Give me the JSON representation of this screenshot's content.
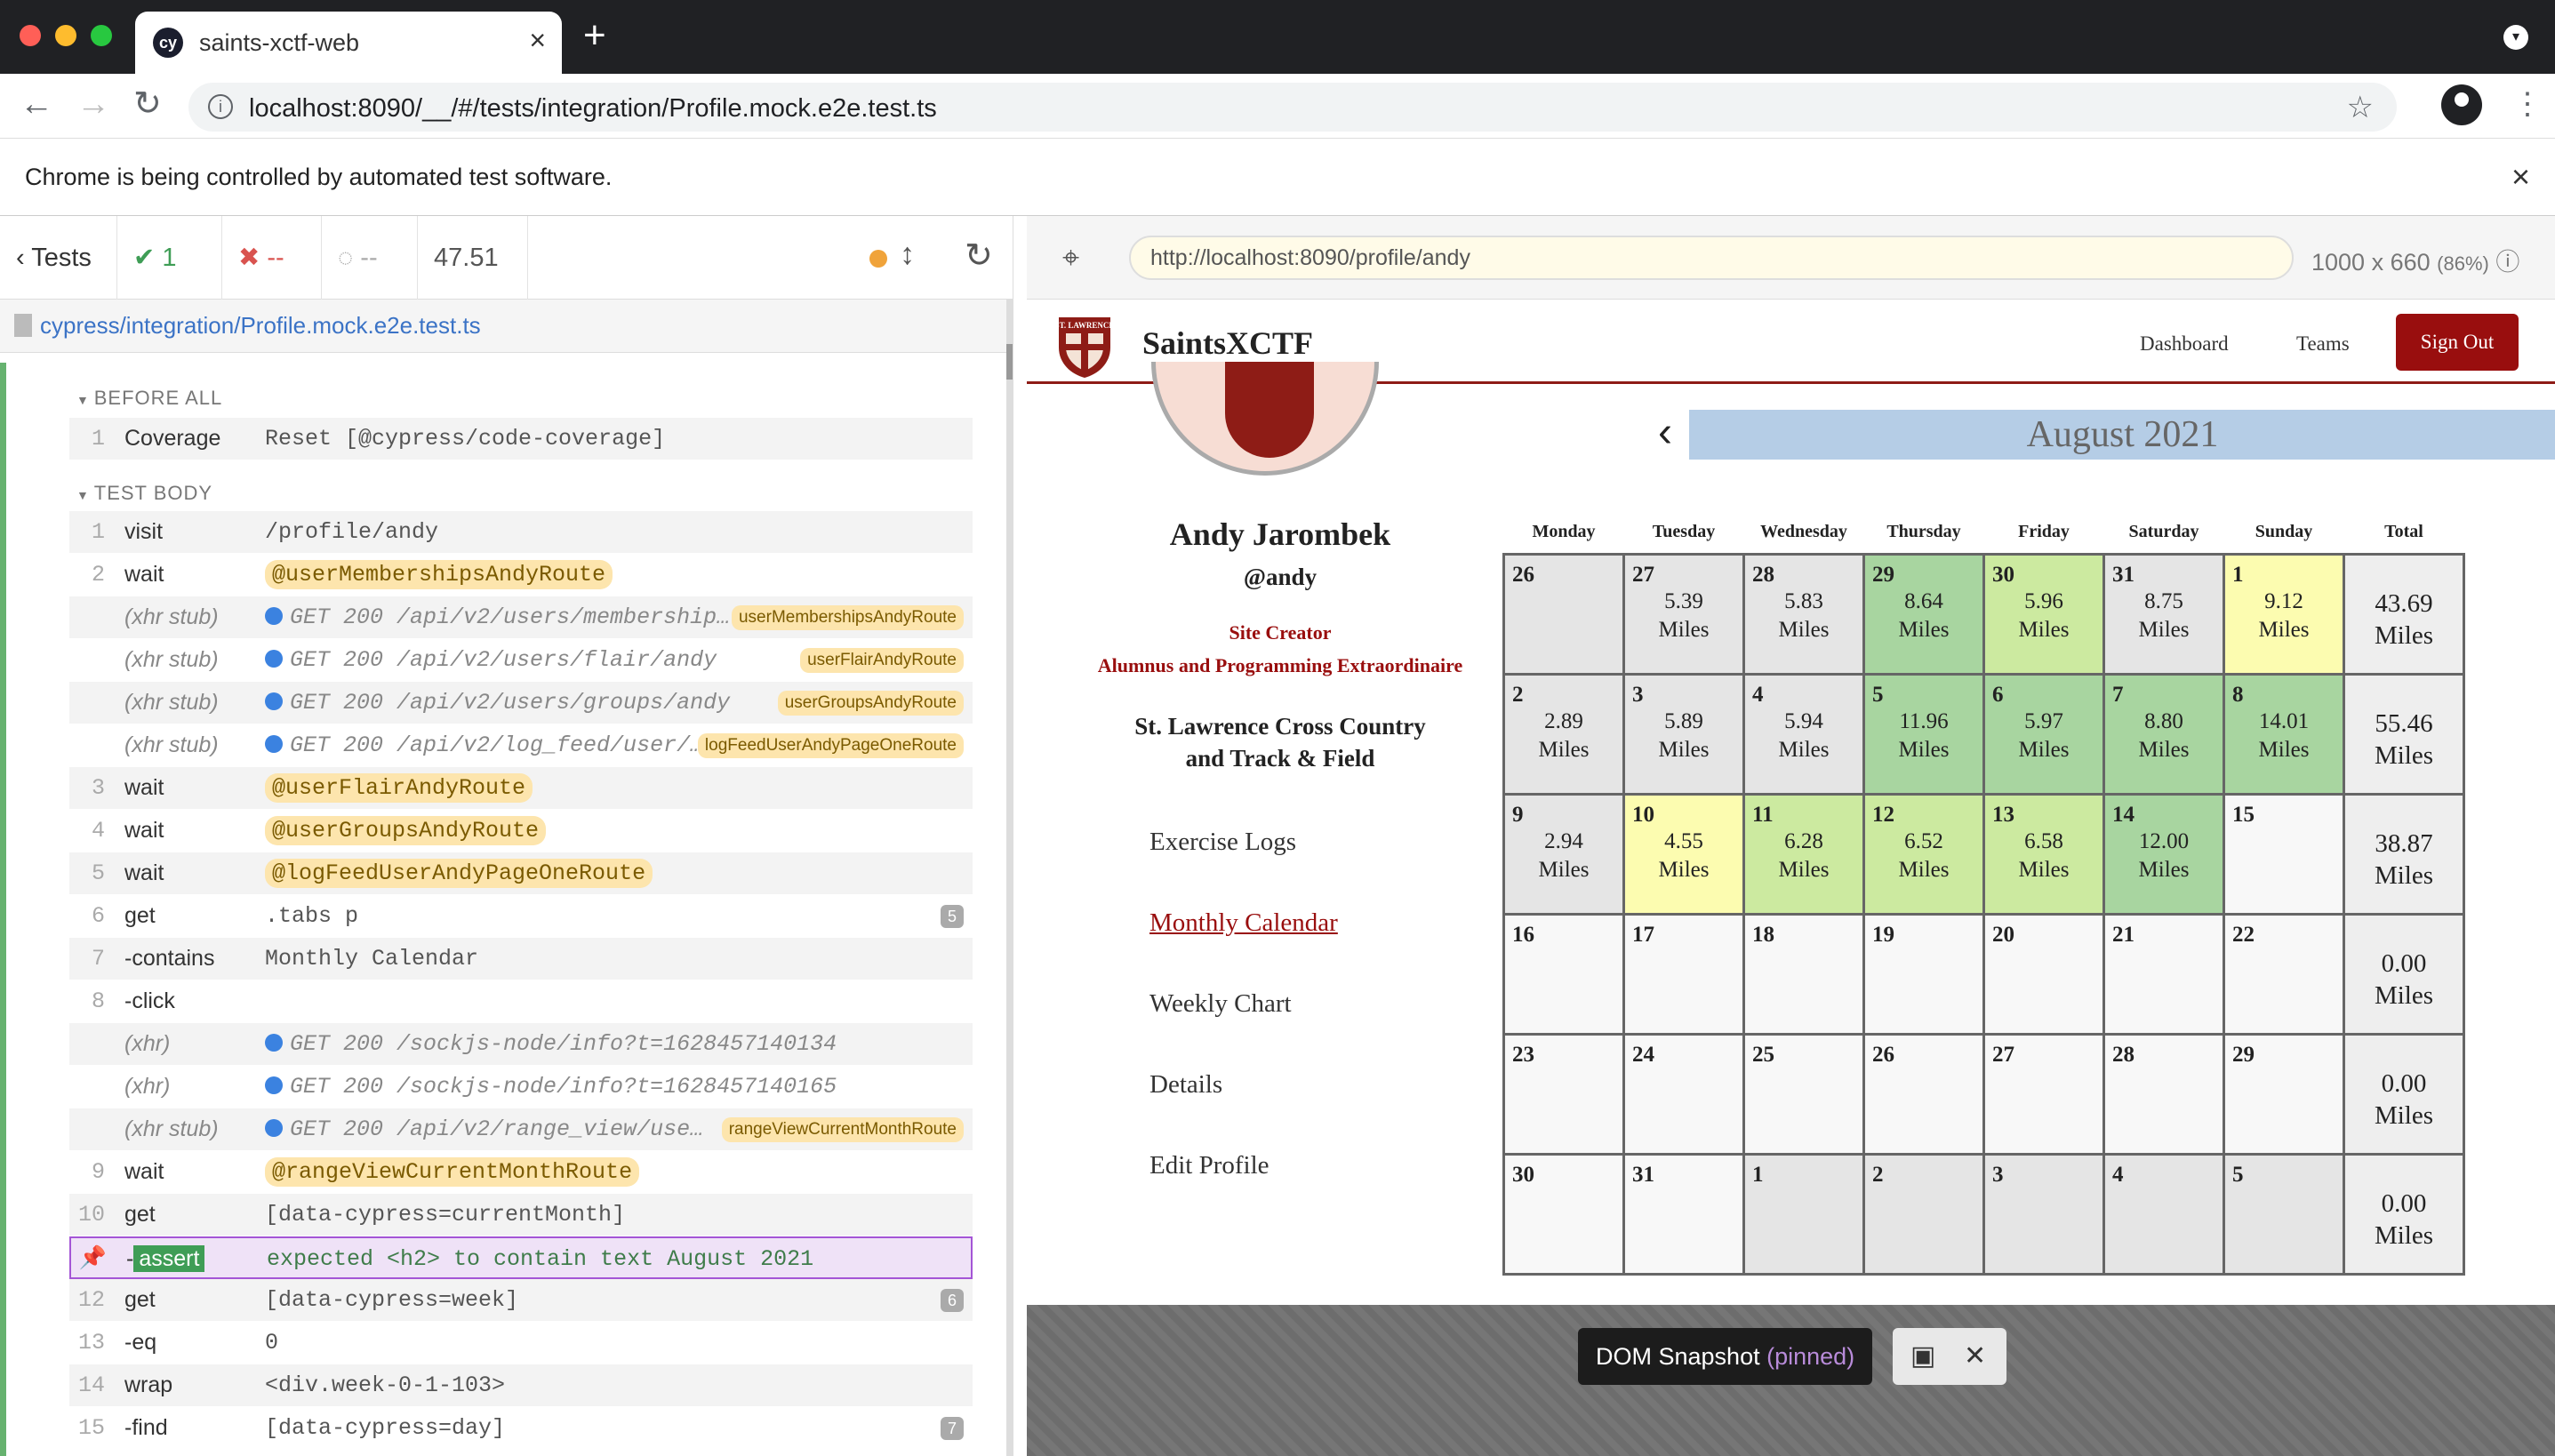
{
  "browser": {
    "tab_title": "saints-xctf-web",
    "favicon_text": "cy",
    "url": "localhost:8090/__/#/tests/integration/Profile.mock.e2e.test.ts",
    "infobar_message": "Chrome is being controlled by automated test software."
  },
  "reporter": {
    "tests_label": "Tests",
    "passed": "1",
    "failed": "--",
    "pending": "--",
    "duration": "47.51",
    "spec_path": "cypress/integration/Profile.mock.e2e.test.ts",
    "before_all_label": "BEFORE ALL",
    "test_body_label": "TEST BODY",
    "before_all": [
      {
        "num": "1",
        "name": "Coverage",
        "msg": "Reset [@cypress/code-coverage]"
      }
    ],
    "commands": [
      {
        "num": "1",
        "name": "visit",
        "msg": "/profile/andy"
      },
      {
        "num": "2",
        "name": "wait",
        "alias": "@userMembershipsAndyRoute"
      },
      {
        "name": "(xhr stub)",
        "xhr": "GET 200 /api/v2/users/membership…",
        "tag": "userMembershipsAndyRoute"
      },
      {
        "name": "(xhr stub)",
        "xhr": "GET 200 /api/v2/users/flair/andy",
        "tag": "userFlairAndyRoute"
      },
      {
        "name": "(xhr stub)",
        "xhr": "GET 200 /api/v2/users/groups/andy",
        "tag": "userGroupsAndyRoute"
      },
      {
        "name": "(xhr stub)",
        "xhr": "GET 200 /api/v2/log_feed/user/…",
        "tag": "logFeedUserAndyPageOneRoute"
      },
      {
        "num": "3",
        "name": "wait",
        "alias": "@userFlairAndyRoute"
      },
      {
        "num": "4",
        "name": "wait",
        "alias": "@userGroupsAndyRoute"
      },
      {
        "num": "5",
        "name": "wait",
        "alias": "@logFeedUserAndyPageOneRoute"
      },
      {
        "num": "6",
        "name": "get",
        "msg": ".tabs p",
        "badge": "5"
      },
      {
        "num": "7",
        "name": "-contains",
        "msg": "Monthly Calendar"
      },
      {
        "num": "8",
        "name": "-click",
        "msg": ""
      },
      {
        "name": "(xhr)",
        "xhr": "GET 200 /sockjs-node/info?t=1628457140134"
      },
      {
        "name": "(xhr)",
        "xhr": "GET 200 /sockjs-node/info?t=1628457140165"
      },
      {
        "name": "(xhr stub)",
        "xhr": "GET 200 /api/v2/range_view/use…",
        "tag": "rangeViewCurrentMonthRoute"
      },
      {
        "num": "9",
        "name": "wait",
        "alias": "@rangeViewCurrentMonthRoute"
      },
      {
        "num": "10",
        "name": "get",
        "msg": "[data-cypress=currentMonth]"
      },
      {
        "num": "",
        "name": "-assert",
        "assert": "expected <h2> to contain text August 2021"
      },
      {
        "num": "12",
        "name": "get",
        "msg": "[data-cypress=week]",
        "badge": "6"
      },
      {
        "num": "13",
        "name": "-eq",
        "msg": "0"
      },
      {
        "num": "14",
        "name": "wrap",
        "msg": "<div.week-0-1-103>"
      },
      {
        "num": "15",
        "name": "-find",
        "msg": "[data-cypress=day]",
        "badge": "7"
      }
    ]
  },
  "aut": {
    "url": "http://localhost:8090/profile/andy",
    "viewport": "1000 x 660",
    "scale": "(86%)"
  },
  "app": {
    "brand": "SaintsXCTF",
    "logo_text": "ST. LAWRENCE",
    "nav": {
      "dashboard": "Dashboard",
      "teams": "Teams",
      "sign_out": "Sign Out"
    },
    "profile": {
      "name": "Andy Jarombek",
      "username": "@andy",
      "flair1": "Site Creator",
      "flair2": "Alumnus and Programming Extraordinaire",
      "group": "St. Lawrence Cross Country and Track & Field"
    },
    "side_links": [
      "Exercise Logs",
      "Monthly Calendar",
      "Weekly Chart",
      "Details",
      "Edit Profile"
    ],
    "calendar": {
      "month": "August 2021",
      "prev": "‹",
      "next": "›",
      "days_of_week": [
        "Monday",
        "Tuesday",
        "Wednesday",
        "Thursday",
        "Friday",
        "Saturday",
        "Sunday",
        "Total"
      ],
      "miles_unit": "Miles",
      "weeks": [
        {
          "days": [
            {
              "d": "26",
              "v": "",
              "c": "other"
            },
            {
              "d": "27",
              "v": "5.39",
              "c": "other"
            },
            {
              "d": "28",
              "v": "5.83",
              "c": "other"
            },
            {
              "d": "29",
              "v": "8.64",
              "c": "g1"
            },
            {
              "d": "30",
              "v": "5.96",
              "c": "g2"
            },
            {
              "d": "31",
              "v": "8.75",
              "c": "other"
            },
            {
              "d": "1",
              "v": "9.12",
              "c": "y"
            }
          ],
          "total": "43.69"
        },
        {
          "days": [
            {
              "d": "2",
              "v": "2.89",
              "c": "other"
            },
            {
              "d": "3",
              "v": "5.89",
              "c": "other"
            },
            {
              "d": "4",
              "v": "5.94",
              "c": "other"
            },
            {
              "d": "5",
              "v": "11.96",
              "c": "g1"
            },
            {
              "d": "6",
              "v": "5.97",
              "c": "g1"
            },
            {
              "d": "7",
              "v": "8.80",
              "c": "g1"
            },
            {
              "d": "8",
              "v": "14.01",
              "c": "g1"
            }
          ],
          "total": "55.46"
        },
        {
          "days": [
            {
              "d": "9",
              "v": "2.94",
              "c": "other"
            },
            {
              "d": "10",
              "v": "4.55",
              "c": "y"
            },
            {
              "d": "11",
              "v": "6.28",
              "c": "g2"
            },
            {
              "d": "12",
              "v": "6.52",
              "c": "g2"
            },
            {
              "d": "13",
              "v": "6.58",
              "c": "g2"
            },
            {
              "d": "14",
              "v": "12.00",
              "c": "g1"
            },
            {
              "d": "15",
              "v": "",
              "c": "empty"
            }
          ],
          "total": "38.87"
        },
        {
          "days": [
            {
              "d": "16",
              "v": "",
              "c": "empty"
            },
            {
              "d": "17",
              "v": "",
              "c": "empty"
            },
            {
              "d": "18",
              "v": "",
              "c": "empty"
            },
            {
              "d": "19",
              "v": "",
              "c": "empty"
            },
            {
              "d": "20",
              "v": "",
              "c": "empty"
            },
            {
              "d": "21",
              "v": "",
              "c": "empty"
            },
            {
              "d": "22",
              "v": "",
              "c": "empty"
            }
          ],
          "total": "0.00"
        },
        {
          "days": [
            {
              "d": "23",
              "v": "",
              "c": "empty"
            },
            {
              "d": "24",
              "v": "",
              "c": "empty"
            },
            {
              "d": "25",
              "v": "",
              "c": "empty"
            },
            {
              "d": "26",
              "v": "",
              "c": "empty"
            },
            {
              "d": "27",
              "v": "",
              "c": "empty"
            },
            {
              "d": "28",
              "v": "",
              "c": "empty"
            },
            {
              "d": "29",
              "v": "",
              "c": "empty"
            }
          ],
          "total": "0.00"
        },
        {
          "days": [
            {
              "d": "30",
              "v": "",
              "c": "empty"
            },
            {
              "d": "31",
              "v": "",
              "c": "empty"
            },
            {
              "d": "1",
              "v": "",
              "c": "other"
            },
            {
              "d": "2",
              "v": "",
              "c": "other"
            },
            {
              "d": "3",
              "v": "",
              "c": "other"
            },
            {
              "d": "4",
              "v": "",
              "c": "other"
            },
            {
              "d": "5",
              "v": "",
              "c": "other"
            }
          ],
          "total": "0.00"
        }
      ]
    }
  },
  "snapshot": {
    "label": "DOM Snapshot",
    "pinned": "(pinned)"
  },
  "colors": {
    "brand_red": "#990e0e",
    "pass_green": "#3f9d56",
    "pin_purple": "#a455d6"
  }
}
